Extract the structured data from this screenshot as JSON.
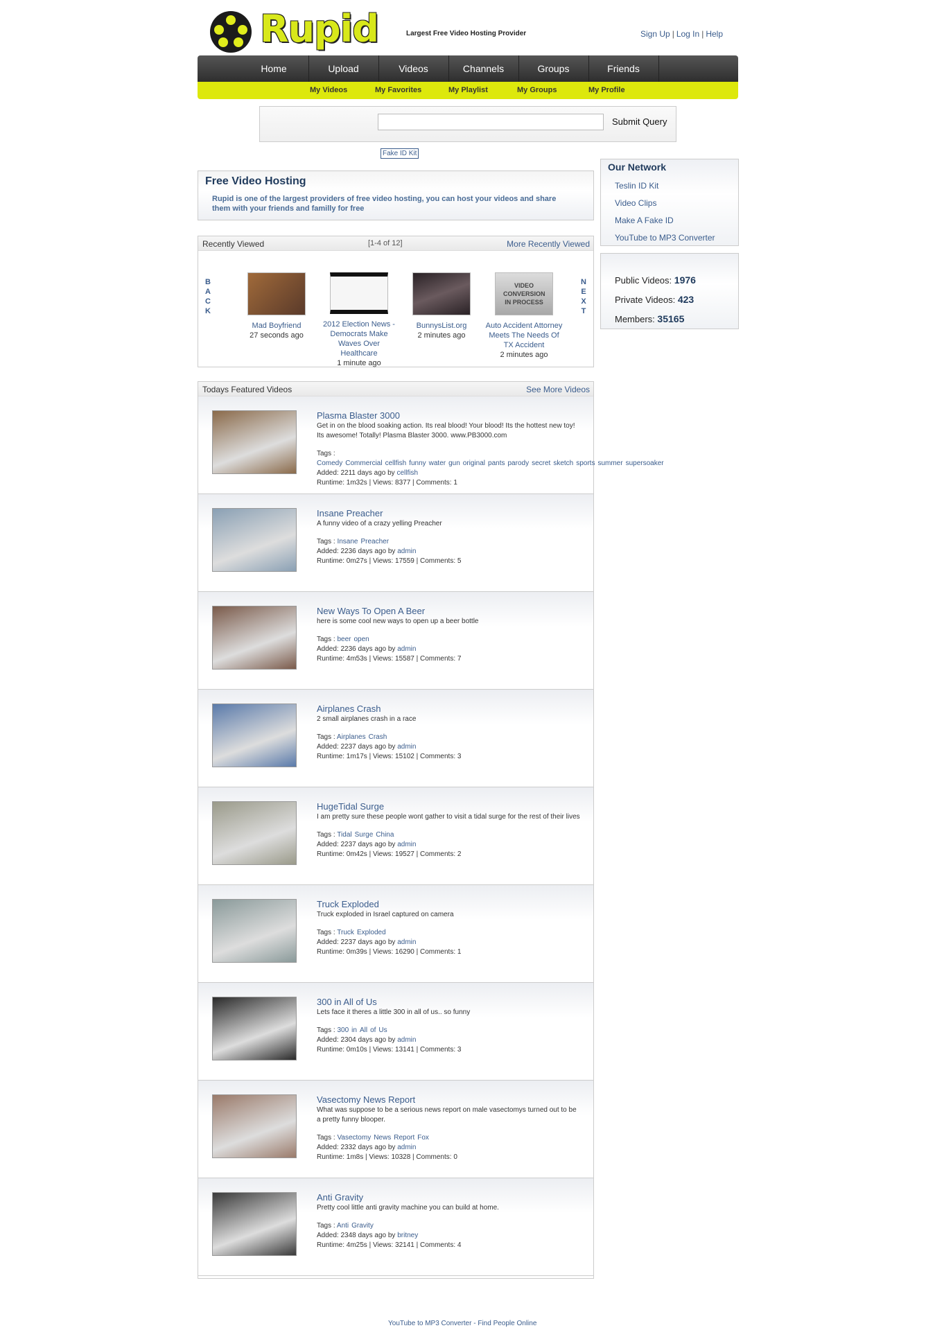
{
  "header": {
    "logo_text": "Rupid",
    "tagline": "Largest Free Video Hosting Provider",
    "links": [
      "Sign Up",
      "Log In",
      "Help"
    ]
  },
  "nav": {
    "items": [
      "Home",
      "Upload",
      "Videos",
      "Channels",
      "Groups",
      "Friends"
    ],
    "sub_items": [
      "My Videos",
      "My Favorites",
      "My Playlist",
      "My Groups",
      "My Profile"
    ]
  },
  "search": {
    "value": "",
    "button_label": "Submit Query",
    "fake_id_link": "Fake ID Kit"
  },
  "free_hosting": {
    "title": "Free Video Hosting",
    "description": "Rupid is one of the largest providers of free video hosting, you can host your videos and share them with your friends and familly for free"
  },
  "recently_viewed": {
    "title": "Recently Viewed",
    "range": "[1-4 of 12]",
    "more_link": "More Recently Viewed",
    "back_label": [
      "B",
      "A",
      "C",
      "K"
    ],
    "next_label": [
      "N",
      "E",
      "X",
      "T"
    ],
    "items": [
      {
        "title": "Mad Boyfriend",
        "ago": "27 seconds ago",
        "thumb_color": "#7a4a2a"
      },
      {
        "title": "2012 Election News - Democrats Make Waves Over Healthcare",
        "ago": "1 minute ago",
        "thumb_color": "#f4f4f4"
      },
      {
        "title": "BunnysList.org",
        "ago": "2 minutes ago",
        "thumb_color": "#3a2a2e"
      },
      {
        "title": "Auto Accident Attorney Meets The Needs Of TX Accident",
        "ago": "2 minutes ago",
        "thumb_text": "VIDEO CONVERSION IN PROCESS",
        "thumb_color": "#bdbdbd"
      }
    ]
  },
  "featured": {
    "title": "Todays Featured Videos",
    "more_link": "See More Videos",
    "tags_label": "Tags :",
    "videos": [
      {
        "title": "Plasma Blaster 3000",
        "desc": "Get in on the blood soaking action. Its real blood! Your blood! Its the hottest new toy! Its awesome! Totally! Plasma Blaster 3000. www.PB3000.com",
        "tags": [
          "Comedy",
          "Commercial",
          "cellfish",
          "funny",
          "water",
          "gun",
          "original",
          "pants",
          "parody",
          "secret",
          "sketch",
          "sports",
          "summer",
          "supersoaker"
        ],
        "added": "Added: 2211 days ago by",
        "user": "cellfish",
        "stats": "Runtime: 1m32s | Views: 8377 | Comments: 1",
        "thumb_color": "#8a6a4a"
      },
      {
        "title": "Insane Preacher",
        "desc": "A funny video of a crazy yelling Preacher",
        "tags": [
          "Insane",
          "Preacher"
        ],
        "added": "Added: 2236 days ago by",
        "user": "admin",
        "stats": "Runtime: 0m27s | Views: 17559 | Comments: 5",
        "thumb_color": "#8aa0b4"
      },
      {
        "title": "New Ways To Open A Beer",
        "desc": "here is some cool new ways to open up a beer bottle",
        "tags": [
          "beer",
          "open"
        ],
        "added": "Added: 2236 days ago by",
        "user": "admin",
        "stats": "Runtime: 4m53s | Views: 15587 | Comments: 7",
        "thumb_color": "#7a5a4a"
      },
      {
        "title": "Airplanes Crash",
        "desc": "2 small airplanes crash in a race",
        "tags": [
          "Airplanes",
          "Crash"
        ],
        "added": "Added: 2237 days ago by",
        "user": "admin",
        "stats": "Runtime: 1m17s | Views: 15102 | Comments: 3",
        "thumb_color": "#5a7aaa"
      },
      {
        "title": "HugeTidal Surge",
        "desc": "I am pretty sure these people wont gather to visit a tidal surge for the rest of their lives",
        "tags": [
          "Tidal",
          "Surge",
          "China"
        ],
        "added": "Added: 2237 days ago by",
        "user": "admin",
        "stats": "Runtime: 0m42s | Views: 19527 | Comments: 2",
        "thumb_color": "#9a9a8a"
      },
      {
        "title": "Truck Exploded",
        "desc": "Truck exploded in Israel captured on camera",
        "tags": [
          "Truck",
          "Exploded"
        ],
        "added": "Added: 2237 days ago by",
        "user": "admin",
        "stats": "Runtime: 0m39s | Views: 16290 | Comments: 1",
        "thumb_color": "#8a9a9a"
      },
      {
        "title": "300 in All of Us",
        "desc": "Lets face it theres a little 300 in all of us.. so funny",
        "tags": [
          "300",
          "in",
          "All",
          "of",
          "Us"
        ],
        "added": "Added: 2304 days ago by",
        "user": "admin",
        "stats": "Runtime: 0m10s | Views: 13141 | Comments: 3",
        "thumb_color": "#2a2a2a"
      },
      {
        "title": "Vasectomy News Report",
        "desc": "What was suppose to be a serious news report on male vasectomys turned out to be a pretty funny blooper.",
        "tags": [
          "Vasectomy",
          "News",
          "Report",
          "Fox"
        ],
        "added": "Added: 2332 days ago by",
        "user": "admin",
        "stats": "Runtime: 1m8s | Views: 10328 | Comments: 0",
        "thumb_color": "#9a7a6a"
      },
      {
        "title": "Anti Gravity",
        "desc": "Pretty cool little anti gravity machine you can build at home.",
        "tags": [
          "Anti",
          "Gravity"
        ],
        "added": "Added: 2348 days ago by",
        "user": "britney",
        "stats": "Runtime: 4m25s | Views: 32141 | Comments: 4",
        "thumb_color": "#3a3a3a"
      }
    ]
  },
  "network": {
    "title": "Our Network",
    "links": [
      "Teslin ID Kit",
      "Video Clips",
      "Make A Fake ID",
      "YouTube to MP3 Converter"
    ]
  },
  "stats": {
    "public_label": "Public Videos:",
    "public_value": "1976",
    "private_label": "Private Videos:",
    "private_value": "423",
    "members_label": "Members:",
    "members_value": "35165"
  },
  "footer": {
    "link1": "YouTube to MP3 Converter",
    "sep": " - ",
    "link2": "Find People Online"
  }
}
